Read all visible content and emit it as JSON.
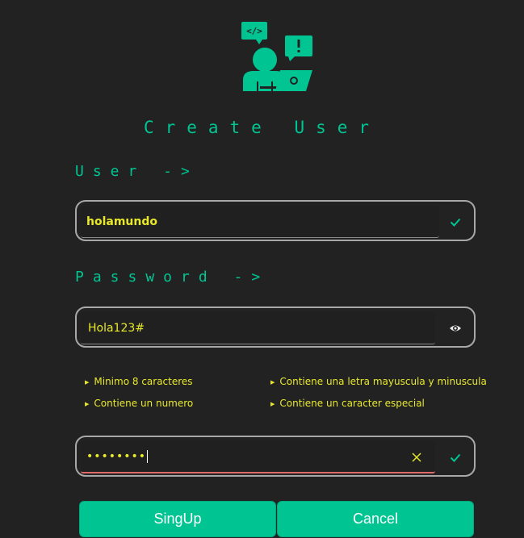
{
  "header": {
    "title": "Create User"
  },
  "user": {
    "label": "User ->",
    "value": "holamundo"
  },
  "password": {
    "label": "Password ->",
    "value": "Hola123#"
  },
  "rules": [
    "Minimo 8 caracteres",
    "Contiene una letra mayuscula y minuscula",
    "Contiene un numero",
    "Contiene un caracter especial"
  ],
  "confirm": {
    "value": "••••••••"
  },
  "buttons": {
    "signup": "SingUp",
    "cancel": "Cancel"
  },
  "colors": {
    "accent": "#00c593",
    "text": "#e8e82a",
    "background": "#222222",
    "error": "#e06a6a"
  },
  "icons": [
    "developer-icon",
    "check-icon",
    "eye-icon",
    "clear-icon"
  ]
}
